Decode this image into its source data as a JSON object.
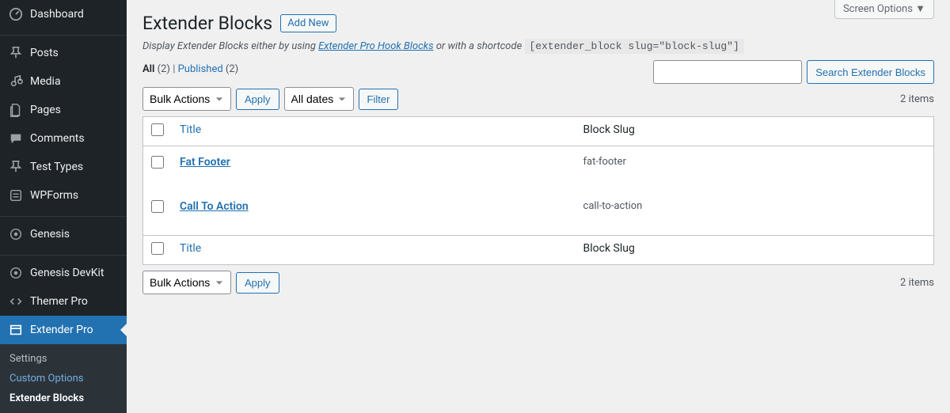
{
  "screen_options": "Screen Options  ▼",
  "sidebar": {
    "items": [
      {
        "label": "Dashboard",
        "icon": "dash"
      },
      {
        "label": "Posts",
        "icon": "pin"
      },
      {
        "label": "Media",
        "icon": "media"
      },
      {
        "label": "Pages",
        "icon": "page"
      },
      {
        "label": "Comments",
        "icon": "comment"
      },
      {
        "label": "Test Types",
        "icon": "pin"
      },
      {
        "label": "WPForms",
        "icon": "form"
      },
      {
        "label": "Genesis",
        "icon": "genesis"
      },
      {
        "label": "Genesis DevKit",
        "icon": "genesis"
      },
      {
        "label": "Themer Pro",
        "icon": "code"
      },
      {
        "label": "Extender Pro",
        "icon": "window"
      }
    ],
    "submenu": [
      {
        "label": "Settings"
      },
      {
        "label": "Custom Options",
        "highlight": true
      },
      {
        "label": "Extender Blocks",
        "active": true
      }
    ]
  },
  "page": {
    "title": "Extender Blocks",
    "add_new": "Add New",
    "subtitle_before": "Display Extender Blocks either by using ",
    "subtitle_link": "Extender Pro Hook Blocks",
    "subtitle_after": " or with a shortcode  ",
    "shortcode": "[extender_block slug=\"block-slug\"]"
  },
  "filters": {
    "all_label": "All",
    "all_count": "(2)",
    "sep": "  |  ",
    "published_label": "Published",
    "published_count": "(2)"
  },
  "search": {
    "button": "Search Extender Blocks"
  },
  "bulk": {
    "actions_label": "Bulk Actions",
    "apply_label": "Apply",
    "dates_label": "All dates",
    "filter_label": "Filter"
  },
  "paging": "2 items",
  "table": {
    "col_title": "Title",
    "col_slug": "Block Slug",
    "rows": [
      {
        "title": "Fat Footer",
        "slug": "fat-footer"
      },
      {
        "title": "Call To Action",
        "slug": "call-to-action"
      }
    ]
  }
}
